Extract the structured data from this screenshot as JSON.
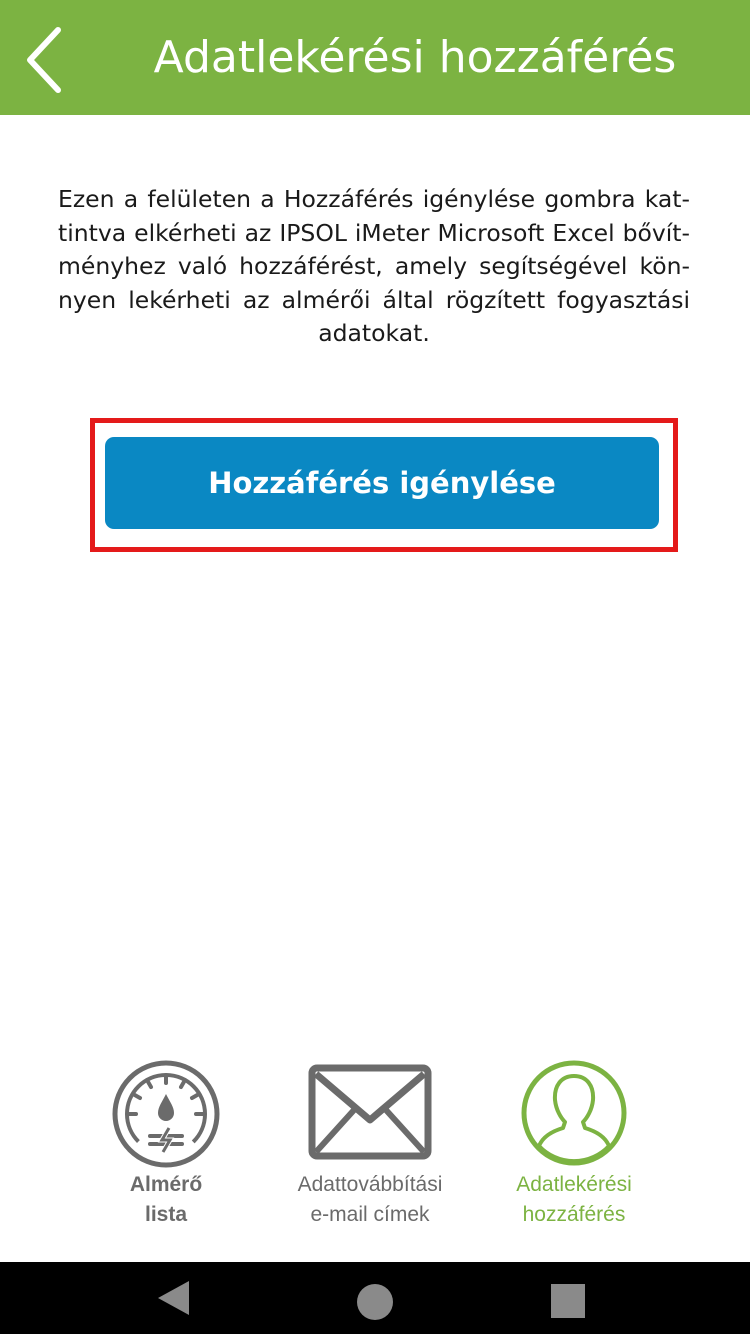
{
  "header": {
    "title": "Adatlekérési hozzáférés",
    "background_color": "#7cb342"
  },
  "main": {
    "description": "Ezen a felületen a Hozzáférés igénylése gombra kat­tintva elkérheti az IPSOL iMeter Microsoft Excel bővít­ményhez való hozzáférést, amely segítségével kön­nyen lekérheti az almérői által rögzített fogyasztási adatokat.",
    "request_button_label": "Hozzáférés igénylése",
    "button_color": "#0a88c3",
    "highlight_color": "#e41a1a"
  },
  "bottom_nav": {
    "items": [
      {
        "line1": "Almérő",
        "line2": "lista",
        "icon": "gauge-icon",
        "active": false
      },
      {
        "line1": "Adattovábbítási",
        "line2": "e-mail címek",
        "icon": "envelope-icon",
        "active": false
      },
      {
        "line1": "Adatlekérési",
        "line2": "hozzáférés",
        "icon": "user-icon",
        "active": true
      }
    ],
    "active_color": "#7cb342",
    "inactive_color": "#6b6b6b"
  },
  "system_nav": {
    "buttons": [
      "back-triangle-icon",
      "home-circle-icon",
      "recents-square-icon"
    ]
  }
}
